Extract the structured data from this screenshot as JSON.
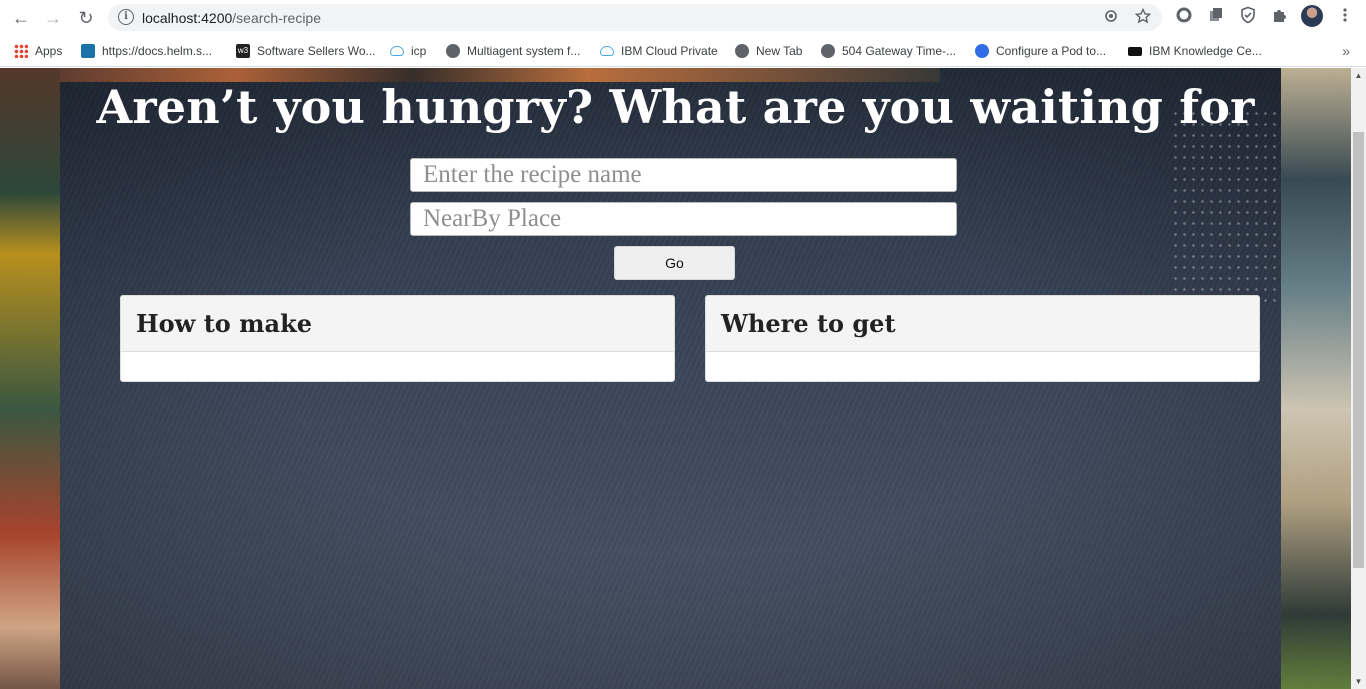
{
  "browser": {
    "url_host": "localhost:4200",
    "url_path": "/search-recipe",
    "nav": {
      "back": "←",
      "forward": "→",
      "reload": "↻"
    },
    "bookmarks": [
      {
        "label": "Apps",
        "icon": "apps-grid-icon"
      },
      {
        "label": "https://docs.helm.s...",
        "icon": "helm-icon"
      },
      {
        "label": "Software Sellers Wo...",
        "icon": "w3-icon"
      },
      {
        "label": "icp",
        "icon": "cloud-icon"
      },
      {
        "label": "Multiagent system f...",
        "icon": "globe-icon"
      },
      {
        "label": "IBM Cloud Private",
        "icon": "cloud-icon"
      },
      {
        "label": "New Tab",
        "icon": "globe-icon"
      },
      {
        "label": "504 Gateway Time-...",
        "icon": "globe-icon"
      },
      {
        "label": "Configure a Pod to...",
        "icon": "kubernetes-icon"
      },
      {
        "label": "IBM Knowledge Ce...",
        "icon": "ibm-icon"
      }
    ],
    "bookmarks_more": "»"
  },
  "page": {
    "heading": "Aren’t you hungry? What are you waiting for",
    "recipe_input": {
      "placeholder": "Enter the recipe name",
      "value": ""
    },
    "place_input": {
      "placeholder": "NearBy Place",
      "value": ""
    },
    "go_label": "Go",
    "cards": [
      {
        "title": "How to make"
      },
      {
        "title": "Where to get"
      }
    ]
  },
  "scrollbar": {
    "up": "▲",
    "down": "▼"
  }
}
